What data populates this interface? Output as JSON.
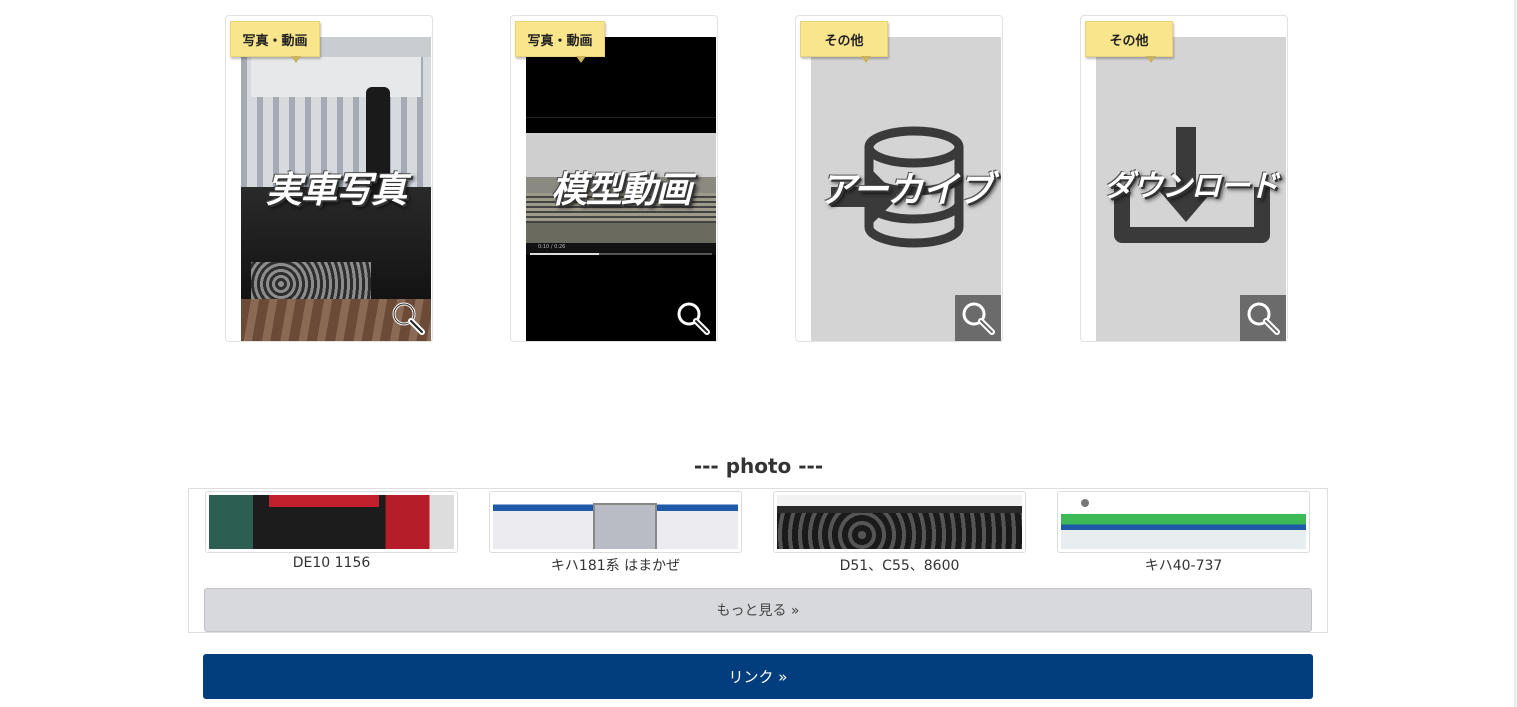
{
  "cards": [
    {
      "tag": "写真・動画",
      "label": "実車写真"
    },
    {
      "tag": "写真・動画",
      "label": "模型動画",
      "video_time": "0:10 / 0:26",
      "video_progress": 0.38
    },
    {
      "tag": "その他",
      "label": "アーカイブ"
    },
    {
      "tag": "その他",
      "label": "ダウンロード"
    }
  ],
  "photo_section": {
    "title": "--- photo ---",
    "items": [
      {
        "caption": "DE10 1156"
      },
      {
        "caption": "キハ181系 はまかぜ"
      },
      {
        "caption": "D51、C55、8600"
      },
      {
        "caption": "キハ40-737"
      }
    ],
    "more_label": "もっと見る »"
  },
  "link_button": {
    "label": "リンク »"
  },
  "colors": {
    "tag_bg": "#f8e58c",
    "link_button_bg": "#023e7d",
    "more_button_bg": "#d7d9dc",
    "card_grey": "#d4d4d4"
  },
  "icons": {
    "zoom": "magnifier-icon",
    "archive": "database-arrow-icon",
    "download": "download-tray-icon"
  }
}
